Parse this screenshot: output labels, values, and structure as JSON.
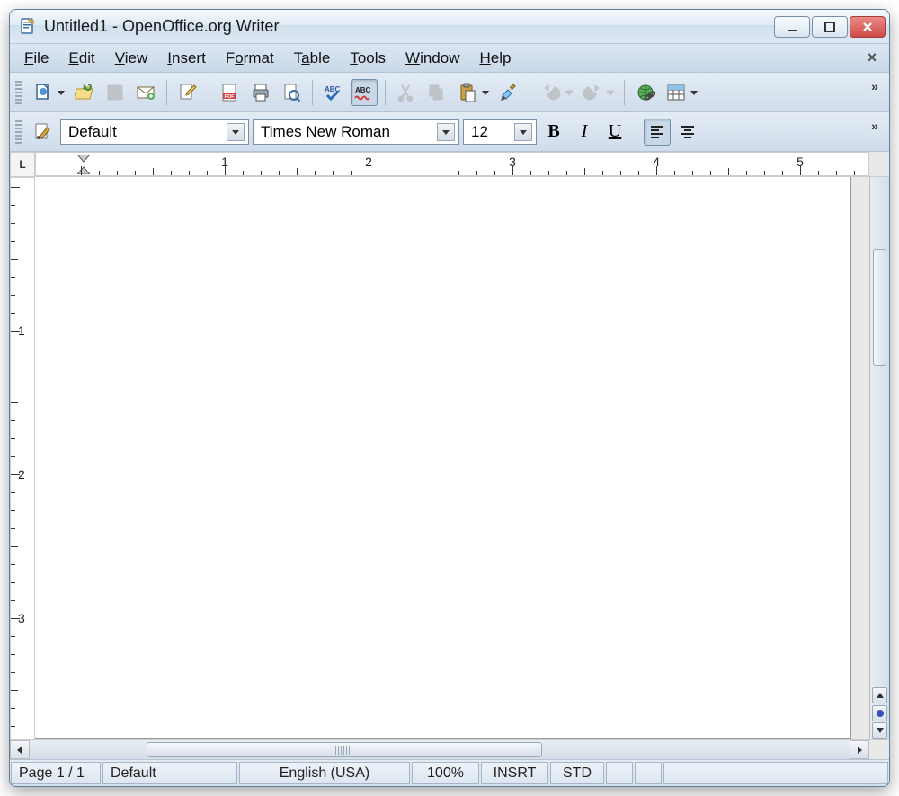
{
  "window": {
    "title": "Untitled1 - OpenOffice.org Writer"
  },
  "menus": {
    "file": "File",
    "edit": "Edit",
    "view": "View",
    "insert": "Insert",
    "format": "Format",
    "table": "Table",
    "tools": "Tools",
    "window": "Window",
    "help": "Help"
  },
  "format_toolbar": {
    "style": "Default",
    "font": "Times New Roman",
    "size": "12",
    "bold": "B",
    "italic": "I",
    "underline": "U"
  },
  "ruler": {
    "h_numbers": [
      "1",
      "2",
      "3",
      "4",
      "5"
    ]
  },
  "status": {
    "page": "Page 1 / 1",
    "style": "Default",
    "lang": "English (USA)",
    "zoom": "100%",
    "insert": "INSRT",
    "selmode": "STD"
  }
}
